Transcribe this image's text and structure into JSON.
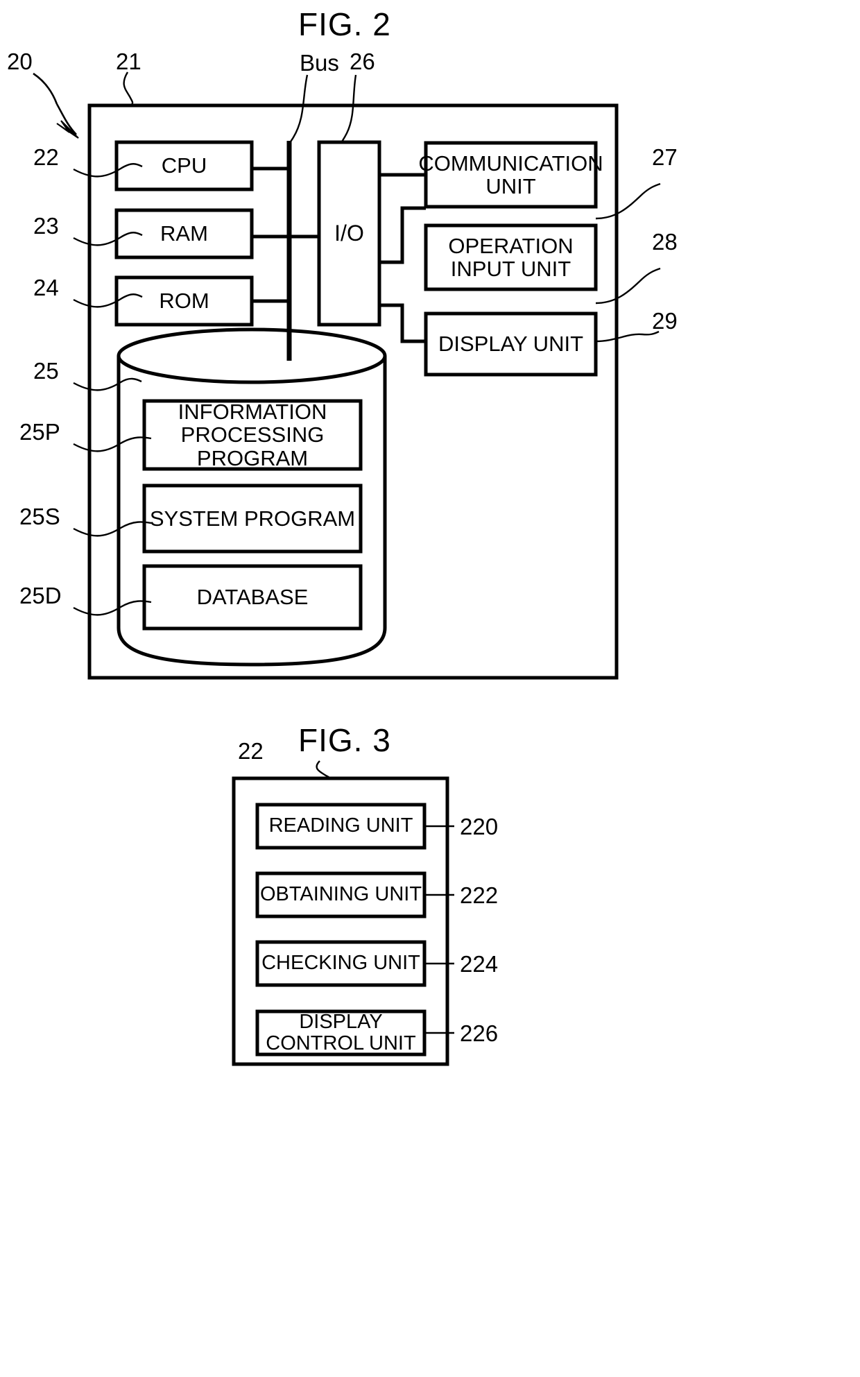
{
  "figures": [
    {
      "id": "fig2",
      "title": "FIG. 2",
      "system_ref": "20",
      "frame_ref": "21",
      "bus_label": "Bus",
      "io_ref": "26",
      "blocks": {
        "cpu": {
          "label": "CPU",
          "ref": "22"
        },
        "ram": {
          "label": "RAM",
          "ref": "23"
        },
        "rom": {
          "label": "ROM",
          "ref": "24"
        },
        "io": {
          "label": "I/O",
          "ref": "26"
        },
        "comm": {
          "label": "COMMUNICATION\nUNIT",
          "ref": "27"
        },
        "operation": {
          "label": "OPERATION\nINPUT UNIT",
          "ref": "28"
        },
        "display": {
          "label": "DISPLAY UNIT",
          "ref": "29"
        },
        "storage": {
          "label": "",
          "ref": "25"
        },
        "program": {
          "label": "INFORMATION\nPROCESSING\nPROGRAM",
          "ref": "25P"
        },
        "system": {
          "label": "SYSTEM PROGRAM",
          "ref": "25S"
        },
        "database": {
          "label": "DATABASE",
          "ref": "25D"
        }
      }
    },
    {
      "id": "fig3",
      "title": "FIG. 3",
      "frame_ref": "22",
      "blocks": [
        {
          "label": "READING UNIT",
          "ref": "220"
        },
        {
          "label": "OBTAINING UNIT",
          "ref": "222"
        },
        {
          "label": "CHECKING UNIT",
          "ref": "224"
        },
        {
          "label": "DISPLAY\nCONTROL UNIT",
          "ref": "226"
        }
      ]
    }
  ],
  "colors": {
    "ink": "#000000",
    "paper": "#ffffff"
  }
}
